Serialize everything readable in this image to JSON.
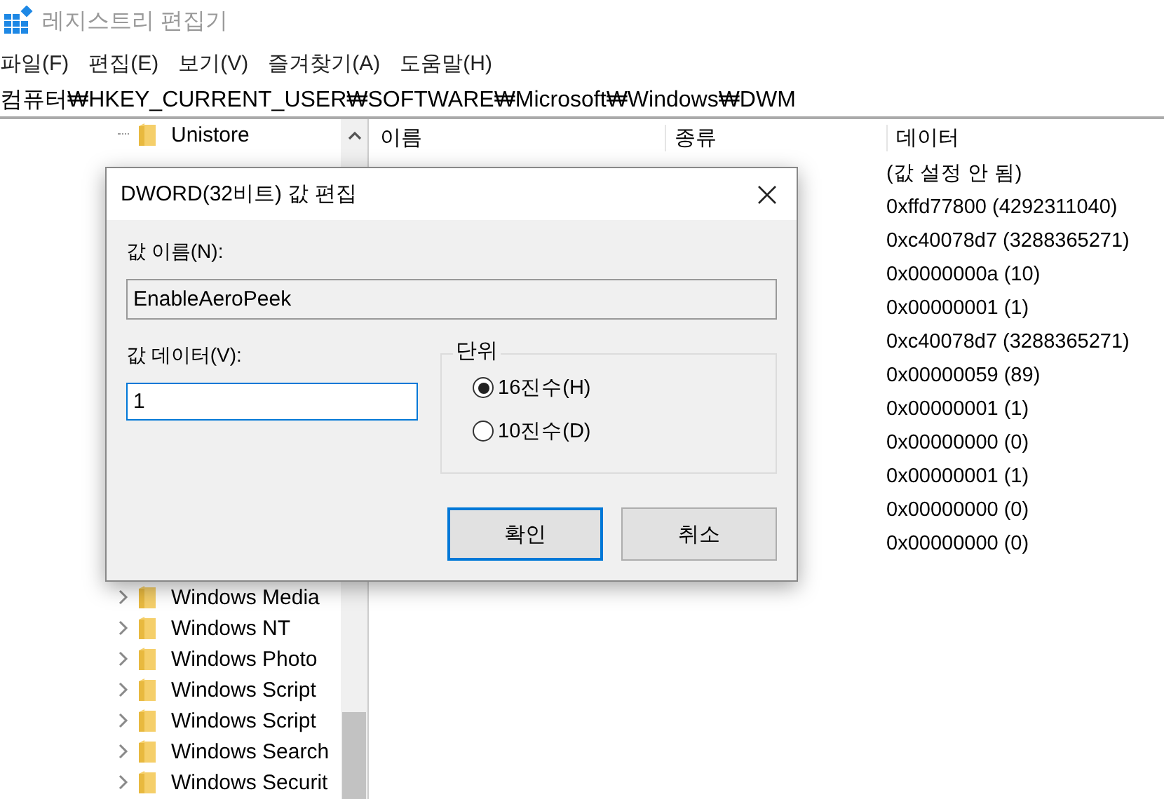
{
  "window": {
    "title": "레지스트리 편집기"
  },
  "menu": [
    "파일(F)",
    "편집(E)",
    "보기(V)",
    "즐겨찾기(A)",
    "도움말(H)"
  ],
  "address": "컴퓨터₩HKEY_CURRENT_USER₩SOFTWARE₩Microsoft₩Windows₩DWM",
  "tree": {
    "top_items": [
      {
        "label": "Unistore",
        "expandable": false
      }
    ],
    "bottom_items": [
      {
        "label": "Windows Media",
        "expandable": true
      },
      {
        "label": "Windows NT",
        "expandable": true
      },
      {
        "label": "Windows Photo",
        "expandable": true
      },
      {
        "label": "Windows Script",
        "expandable": true
      },
      {
        "label": "Windows Script",
        "expandable": true
      },
      {
        "label": "Windows Search",
        "expandable": true
      },
      {
        "label": "Windows Securit",
        "expandable": true
      }
    ]
  },
  "values": {
    "columns": [
      "이름",
      "종류",
      "데이터"
    ],
    "data": [
      "(값 설정 안 됨)",
      "0xffd77800 (4292311040)",
      "0xc40078d7 (3288365271)",
      "0x0000000a (10)",
      "0x00000001 (1)",
      "0xc40078d7 (3288365271)",
      "0x00000059 (89)",
      "0x00000001 (1)",
      "0x00000000 (0)",
      "0x00000001 (1)",
      "0x00000000 (0)",
      "0x00000000 (0)"
    ]
  },
  "dialog": {
    "title": "DWORD(32비트) 값 편집",
    "name_label": "값 이름(N):",
    "name_value": "EnableAeroPeek",
    "data_label": "값 데이터(V):",
    "data_value": "1",
    "base_label": "단위",
    "bases": [
      {
        "label": "16진수(H)",
        "selected": true
      },
      {
        "label": "10진수(D)",
        "selected": false
      }
    ],
    "buttons": [
      {
        "label": "확인",
        "default": true
      },
      {
        "label": "취소",
        "default": false
      }
    ]
  }
}
